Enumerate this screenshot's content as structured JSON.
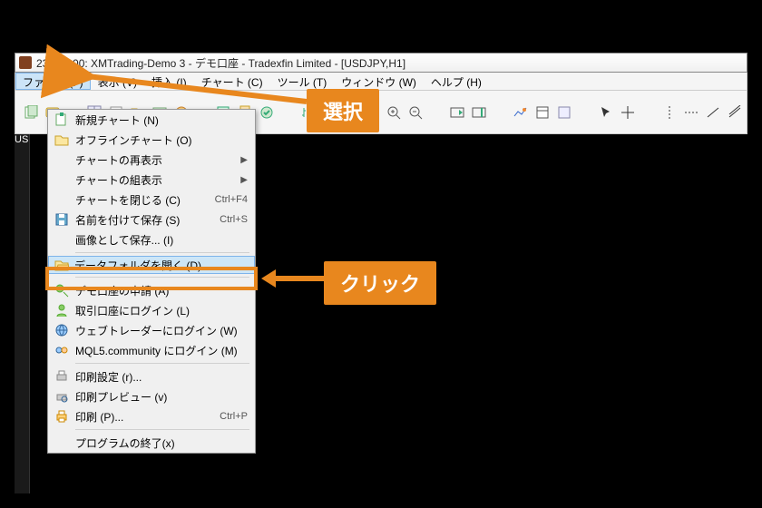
{
  "title": "23672900: XMTrading-Demo 3 - デモ口座 - Tradexfin Limited - [USDJPY,H1]",
  "menus": {
    "file": "ファイル (F)",
    "view": "表示 (V)",
    "insert": "挿入 (I)",
    "chart": "チャート (C)",
    "tool": "ツール (T)",
    "window": "ウィンドウ (W)",
    "help": "ヘルプ (H)"
  },
  "sidebar_tab": "US",
  "file_menu": {
    "new_chart": {
      "label": "新規チャート (N)"
    },
    "offline_chart": {
      "label": "オフラインチャート (O)"
    },
    "chart_redisplay": {
      "label": "チャートの再表示",
      "submenu": true
    },
    "chart_group": {
      "label": "チャートの組表示",
      "submenu": true
    },
    "close_chart": {
      "label": "チャートを閉じる (C)",
      "shortcut": "Ctrl+F4"
    },
    "save_as": {
      "label": "名前を付けて保存 (S)",
      "shortcut": "Ctrl+S"
    },
    "save_image": {
      "label": "画像として保存... (I)"
    },
    "open_data_folder": {
      "label": "データフォルダを開く (D)"
    },
    "apply_demo": {
      "label": "デモ口座の申請 (A)"
    },
    "login_trading": {
      "label": "取引口座にログイン (L)"
    },
    "login_web": {
      "label": "ウェブトレーダーにログイン (W)"
    },
    "login_mql5": {
      "label": "MQL5.community にログイン (M)"
    },
    "print_setup": {
      "label": "印刷設定 (r)..."
    },
    "print_preview": {
      "label": "印刷プレビュー (v)"
    },
    "print": {
      "label": "印刷 (P)...",
      "shortcut": "Ctrl+P"
    },
    "exit": {
      "label": "プログラムの終了(x)"
    }
  },
  "callouts": {
    "select": "選択",
    "click": "クリック"
  }
}
